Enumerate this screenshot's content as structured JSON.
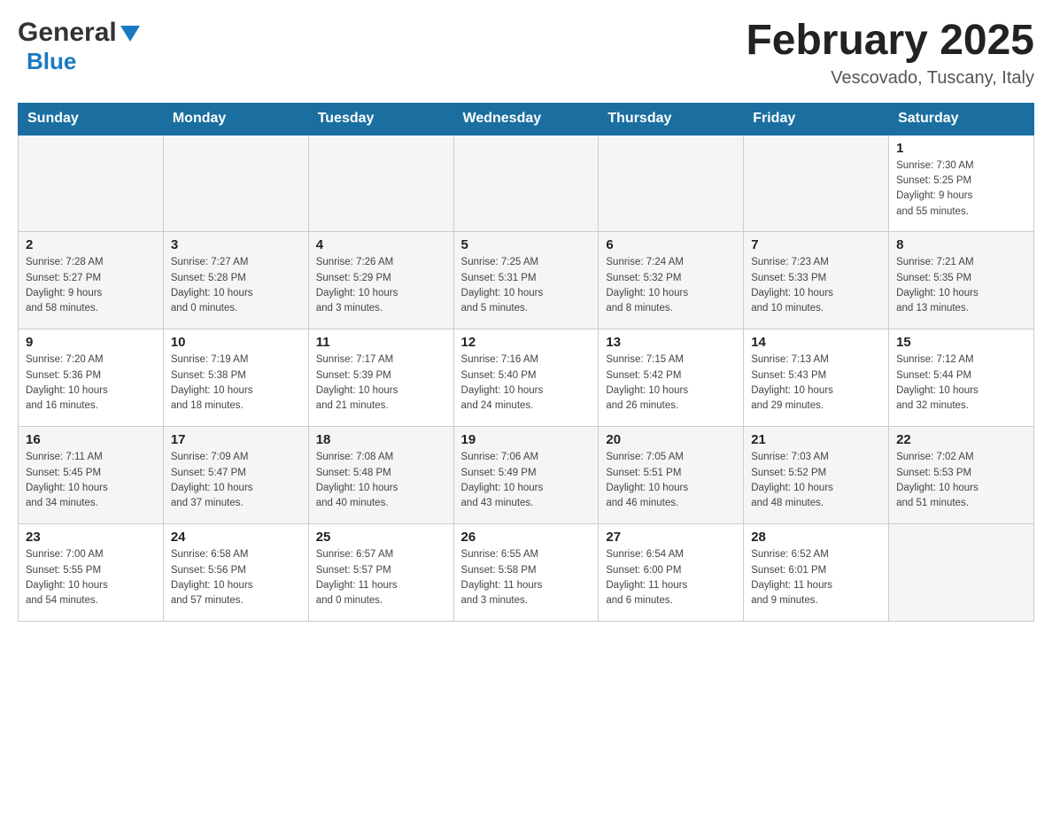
{
  "header": {
    "logo_general": "General",
    "logo_blue": "Blue",
    "title": "February 2025",
    "location": "Vescovado, Tuscany, Italy"
  },
  "days_of_week": [
    "Sunday",
    "Monday",
    "Tuesday",
    "Wednesday",
    "Thursday",
    "Friday",
    "Saturday"
  ],
  "weeks": [
    {
      "days": [
        {
          "date": "",
          "info": ""
        },
        {
          "date": "",
          "info": ""
        },
        {
          "date": "",
          "info": ""
        },
        {
          "date": "",
          "info": ""
        },
        {
          "date": "",
          "info": ""
        },
        {
          "date": "",
          "info": ""
        },
        {
          "date": "1",
          "info": "Sunrise: 7:30 AM\nSunset: 5:25 PM\nDaylight: 9 hours\nand 55 minutes."
        }
      ]
    },
    {
      "days": [
        {
          "date": "2",
          "info": "Sunrise: 7:28 AM\nSunset: 5:27 PM\nDaylight: 9 hours\nand 58 minutes."
        },
        {
          "date": "3",
          "info": "Sunrise: 7:27 AM\nSunset: 5:28 PM\nDaylight: 10 hours\nand 0 minutes."
        },
        {
          "date": "4",
          "info": "Sunrise: 7:26 AM\nSunset: 5:29 PM\nDaylight: 10 hours\nand 3 minutes."
        },
        {
          "date": "5",
          "info": "Sunrise: 7:25 AM\nSunset: 5:31 PM\nDaylight: 10 hours\nand 5 minutes."
        },
        {
          "date": "6",
          "info": "Sunrise: 7:24 AM\nSunset: 5:32 PM\nDaylight: 10 hours\nand 8 minutes."
        },
        {
          "date": "7",
          "info": "Sunrise: 7:23 AM\nSunset: 5:33 PM\nDaylight: 10 hours\nand 10 minutes."
        },
        {
          "date": "8",
          "info": "Sunrise: 7:21 AM\nSunset: 5:35 PM\nDaylight: 10 hours\nand 13 minutes."
        }
      ]
    },
    {
      "days": [
        {
          "date": "9",
          "info": "Sunrise: 7:20 AM\nSunset: 5:36 PM\nDaylight: 10 hours\nand 16 minutes."
        },
        {
          "date": "10",
          "info": "Sunrise: 7:19 AM\nSunset: 5:38 PM\nDaylight: 10 hours\nand 18 minutes."
        },
        {
          "date": "11",
          "info": "Sunrise: 7:17 AM\nSunset: 5:39 PM\nDaylight: 10 hours\nand 21 minutes."
        },
        {
          "date": "12",
          "info": "Sunrise: 7:16 AM\nSunset: 5:40 PM\nDaylight: 10 hours\nand 24 minutes."
        },
        {
          "date": "13",
          "info": "Sunrise: 7:15 AM\nSunset: 5:42 PM\nDaylight: 10 hours\nand 26 minutes."
        },
        {
          "date": "14",
          "info": "Sunrise: 7:13 AM\nSunset: 5:43 PM\nDaylight: 10 hours\nand 29 minutes."
        },
        {
          "date": "15",
          "info": "Sunrise: 7:12 AM\nSunset: 5:44 PM\nDaylight: 10 hours\nand 32 minutes."
        }
      ]
    },
    {
      "days": [
        {
          "date": "16",
          "info": "Sunrise: 7:11 AM\nSunset: 5:45 PM\nDaylight: 10 hours\nand 34 minutes."
        },
        {
          "date": "17",
          "info": "Sunrise: 7:09 AM\nSunset: 5:47 PM\nDaylight: 10 hours\nand 37 minutes."
        },
        {
          "date": "18",
          "info": "Sunrise: 7:08 AM\nSunset: 5:48 PM\nDaylight: 10 hours\nand 40 minutes."
        },
        {
          "date": "19",
          "info": "Sunrise: 7:06 AM\nSunset: 5:49 PM\nDaylight: 10 hours\nand 43 minutes."
        },
        {
          "date": "20",
          "info": "Sunrise: 7:05 AM\nSunset: 5:51 PM\nDaylight: 10 hours\nand 46 minutes."
        },
        {
          "date": "21",
          "info": "Sunrise: 7:03 AM\nSunset: 5:52 PM\nDaylight: 10 hours\nand 48 minutes."
        },
        {
          "date": "22",
          "info": "Sunrise: 7:02 AM\nSunset: 5:53 PM\nDaylight: 10 hours\nand 51 minutes."
        }
      ]
    },
    {
      "days": [
        {
          "date": "23",
          "info": "Sunrise: 7:00 AM\nSunset: 5:55 PM\nDaylight: 10 hours\nand 54 minutes."
        },
        {
          "date": "24",
          "info": "Sunrise: 6:58 AM\nSunset: 5:56 PM\nDaylight: 10 hours\nand 57 minutes."
        },
        {
          "date": "25",
          "info": "Sunrise: 6:57 AM\nSunset: 5:57 PM\nDaylight: 11 hours\nand 0 minutes."
        },
        {
          "date": "26",
          "info": "Sunrise: 6:55 AM\nSunset: 5:58 PM\nDaylight: 11 hours\nand 3 minutes."
        },
        {
          "date": "27",
          "info": "Sunrise: 6:54 AM\nSunset: 6:00 PM\nDaylight: 11 hours\nand 6 minutes."
        },
        {
          "date": "28",
          "info": "Sunrise: 6:52 AM\nSunset: 6:01 PM\nDaylight: 11 hours\nand 9 minutes."
        },
        {
          "date": "",
          "info": ""
        }
      ]
    }
  ]
}
